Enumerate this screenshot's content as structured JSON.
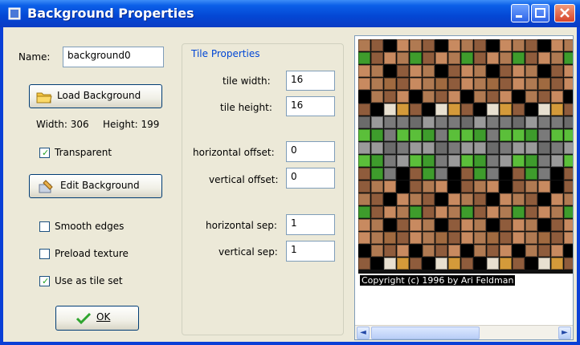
{
  "window": {
    "title": "Background Properties"
  },
  "left": {
    "name_label": "Name:",
    "name_value": "background0",
    "load_button": "Load Background",
    "width_text": "Width: 306",
    "height_text": "Height: 199",
    "transparent_label": "Transparent",
    "transparent_checked": true,
    "edit_button": "Edit Background",
    "smooth_label": "Smooth edges",
    "smooth_checked": false,
    "preload_label": "Preload texture",
    "preload_checked": false,
    "tileset_label": "Use as tile set",
    "tileset_checked": true,
    "ok_button": "OK"
  },
  "tile_properties": {
    "title": "Tile Properties",
    "tile_width_label": "tile width:",
    "tile_width_value": "16",
    "tile_height_label": "tile height:",
    "tile_height_value": "16",
    "h_offset_label": "horizontal offset:",
    "h_offset_value": "0",
    "v_offset_label": "vertical offset:",
    "v_offset_value": "0",
    "h_sep_label": "horizontal sep:",
    "h_sep_value": "1",
    "v_sep_label": "vertical sep:",
    "v_sep_value": "1"
  },
  "preview": {
    "copyright_text": "Copyright (c) 1996 by Ari Feldman"
  },
  "colors": {
    "titlebar": "#0a46d6",
    "dialog_bg": "#ece9d8",
    "group_title": "#0046d5",
    "check_mark": "#21a121"
  },
  "icons": [
    "window-icon",
    "minimize-icon",
    "maximize-icon",
    "close-icon",
    "folder-icon",
    "edit-icon",
    "checkmark-icon",
    "arrow-left-icon",
    "arrow-right-icon"
  ]
}
